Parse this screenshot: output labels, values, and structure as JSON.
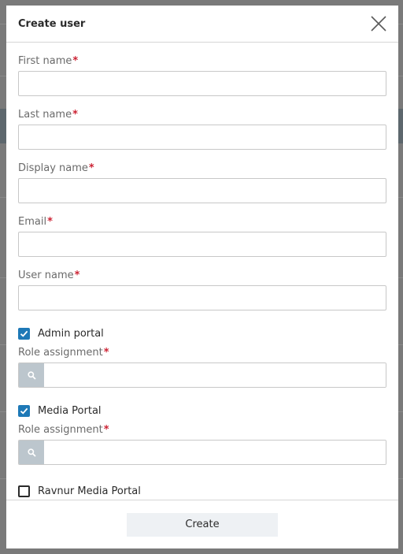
{
  "modal": {
    "title": "Create user"
  },
  "fields": {
    "first_name": {
      "label": "First name",
      "required_mark": "*",
      "value": ""
    },
    "last_name": {
      "label": "Last name",
      "required_mark": "*",
      "value": ""
    },
    "display_name": {
      "label": "Display name",
      "required_mark": "*",
      "value": ""
    },
    "email": {
      "label": "Email",
      "required_mark": "*",
      "value": ""
    },
    "user_name": {
      "label": "User name",
      "required_mark": "*",
      "value": ""
    }
  },
  "portals": {
    "admin": {
      "label": "Admin portal",
      "checked": true,
      "role_label": "Role assignment",
      "required_mark": "*",
      "search_value": ""
    },
    "media": {
      "label": "Media Portal",
      "checked": true,
      "role_label": "Role assignment",
      "required_mark": "*",
      "search_value": ""
    },
    "ravnur": {
      "label": "Ravnur Media Portal",
      "checked": false
    }
  },
  "footer": {
    "create_label": "Create"
  },
  "colors": {
    "accent": "#1e79b7",
    "required": "#cc2233"
  },
  "icons": {
    "close": "close-icon",
    "check": "checkmark-icon",
    "search": "search-icon"
  }
}
